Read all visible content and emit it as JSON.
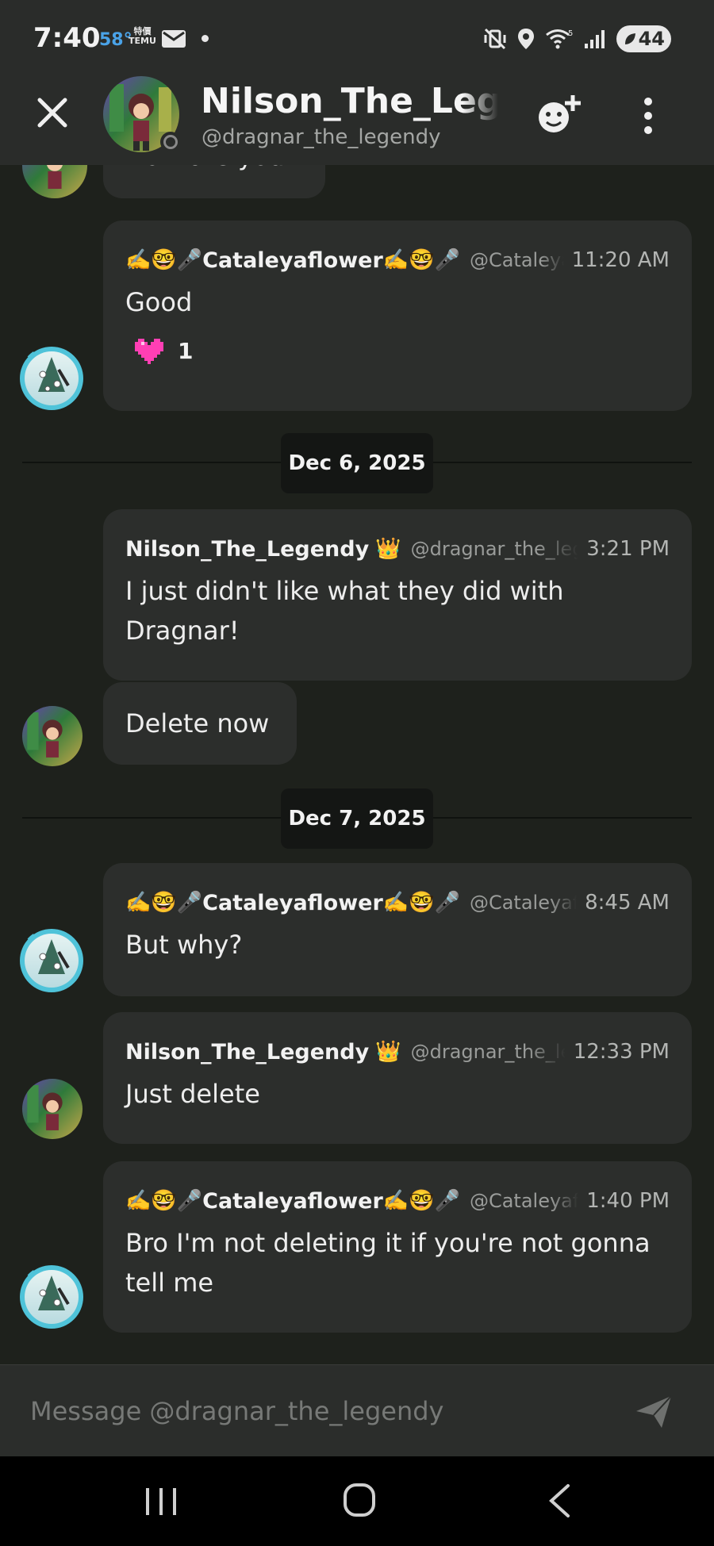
{
  "status_bar": {
    "time": "7:40",
    "temperature": "58°",
    "notif_app_top": "特價",
    "notif_app_bottom": "TEMU",
    "battery": "44",
    "icons": [
      "mail-icon",
      "dot-icon",
      "mute-vibrate-icon",
      "location-icon",
      "wifi-icon",
      "signal-icon",
      "battery-icon"
    ]
  },
  "header": {
    "name": "Nilson_The_Legendy",
    "handle": "@dragnar_the_legendy",
    "icons": [
      "close-icon",
      "add-friend-icon",
      "more-vertical-icon"
    ]
  },
  "messages": {
    "partial_text": "How are you?",
    "m1": {
      "author_prefix": "✍️🤓🎤",
      "author": "Cataleyaflower",
      "author_suffix": "✍️🤓🎤",
      "handle": "@Cataleyaflower",
      "time": "11:20 AM",
      "text": "Good",
      "reaction_count": "1"
    },
    "date1": "Dec 6, 2025",
    "m2": {
      "author": "Nilson_The_Legendy",
      "badge": "👑",
      "handle": "@dragnar_the_legendy",
      "time": "3:21 PM",
      "text": "I just didn't like what they did with Dragnar!"
    },
    "m3": {
      "text": "Delete now"
    },
    "date2": "Dec 7, 2025",
    "m4": {
      "author_prefix": "✍️🤓🎤",
      "author": "Cataleyaflower",
      "author_suffix": "✍️🤓🎤",
      "handle": "@Cataleyaflower",
      "time": "8:45 AM",
      "text": "But why?"
    },
    "m5": {
      "author": "Nilson_The_Legendy",
      "badge": "👑",
      "handle": "@dragnar_the_legendy",
      "time": "12:33 PM",
      "text": "Just delete"
    },
    "m6": {
      "author_prefix": "✍️🤓🎤",
      "author": "Cataleyaflower",
      "author_suffix": "✍️🤓🎤",
      "handle": "@Cataleyaflower",
      "time": "1:40 PM",
      "text": "Bro I'm not deleting it if you're not gonna tell me"
    }
  },
  "composer": {
    "placeholder": "Message @dragnar_the_legendy"
  },
  "colors": {
    "background": "#1e211c",
    "bubble": "#2c2e2c",
    "bar": "#2a2c2a",
    "heart": "#ff3fb4",
    "temp": "#4aa3e8"
  }
}
